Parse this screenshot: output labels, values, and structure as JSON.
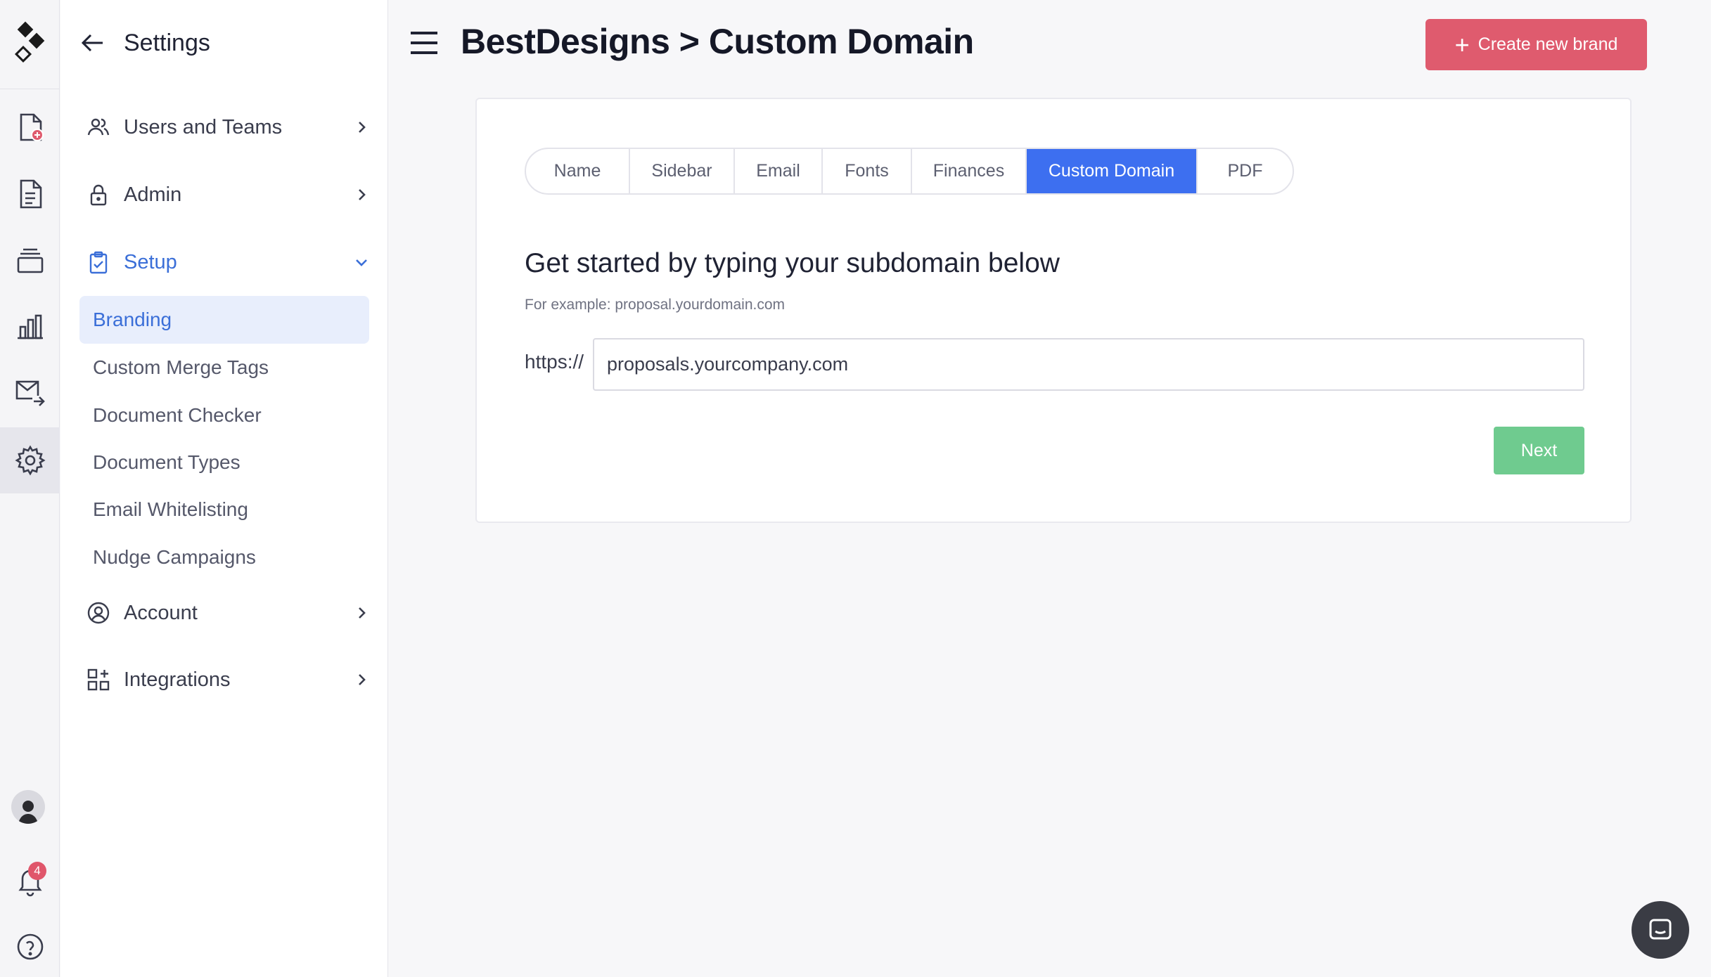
{
  "sidebar": {
    "title": "Settings",
    "items": [
      {
        "label": "Users and Teams"
      },
      {
        "label": "Admin"
      },
      {
        "label": "Setup"
      },
      {
        "label": "Account"
      },
      {
        "label": "Integrations"
      }
    ],
    "setup_sub": [
      {
        "label": "Branding",
        "active": true
      },
      {
        "label": "Custom Merge Tags"
      },
      {
        "label": "Document Checker"
      },
      {
        "label": "Document Types"
      },
      {
        "label": "Email Whitelisting"
      },
      {
        "label": "Nudge Campaigns"
      }
    ]
  },
  "rail": {
    "notification_count": "4",
    "icons": [
      "new-document-icon",
      "document-icon",
      "stack-icon",
      "bar-chart-icon",
      "mail-forward-icon",
      "gear-icon",
      "avatar",
      "bell-icon",
      "help-icon"
    ]
  },
  "header": {
    "title": "BestDesigns > Custom Domain",
    "create_label": "Create new brand"
  },
  "tabs": [
    "Name",
    "Sidebar",
    "Email",
    "Fonts",
    "Finances",
    "Custom Domain",
    "PDF"
  ],
  "active_tab": "Custom Domain",
  "form": {
    "heading": "Get started by typing your subdomain below",
    "example": "For example: proposal.yourdomain.com",
    "prefix": "https://",
    "value": "proposals.yourcompany.com",
    "next_label": "Next"
  },
  "colors": {
    "accent_blue": "#3d6ff0",
    "create_red": "#df5b6e",
    "next_green": "#6fcb8f",
    "badge_red": "#e0566b"
  }
}
